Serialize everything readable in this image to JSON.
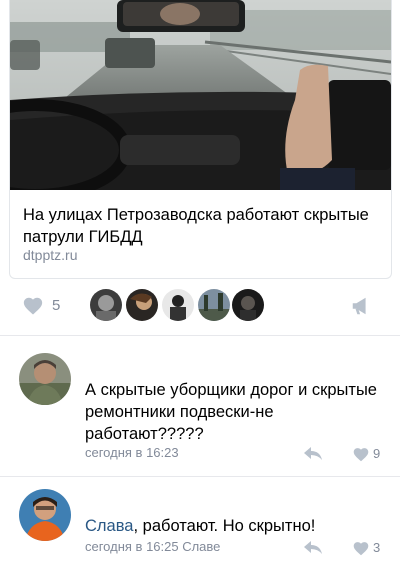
{
  "post": {
    "link_card": {
      "title": "На улицах Петрозаводска работают скрытые патрули ГИБДД",
      "domain": "dtpptz.ru"
    },
    "likes_count": "5",
    "like_icon": "heart-icon",
    "share_icon": "megaphone-icon",
    "likers": [
      "liker-1",
      "liker-2",
      "liker-3",
      "liker-4",
      "liker-5"
    ]
  },
  "comments": [
    {
      "author": "",
      "text": "А скрытые уборщики дорог и скрытые ремонтники подвески-не работают?????",
      "meta": "сегодня в 16:23",
      "likes": "9"
    },
    {
      "author": "Слава",
      "text": ", работают. Но скрытно!",
      "meta": "сегодня в 16:25 Славе",
      "likes": "3"
    }
  ],
  "colors": {
    "link": "#2a5885",
    "secondary": "#828a99",
    "icon": "#b8c1cc",
    "divider": "#e7e8ec"
  }
}
